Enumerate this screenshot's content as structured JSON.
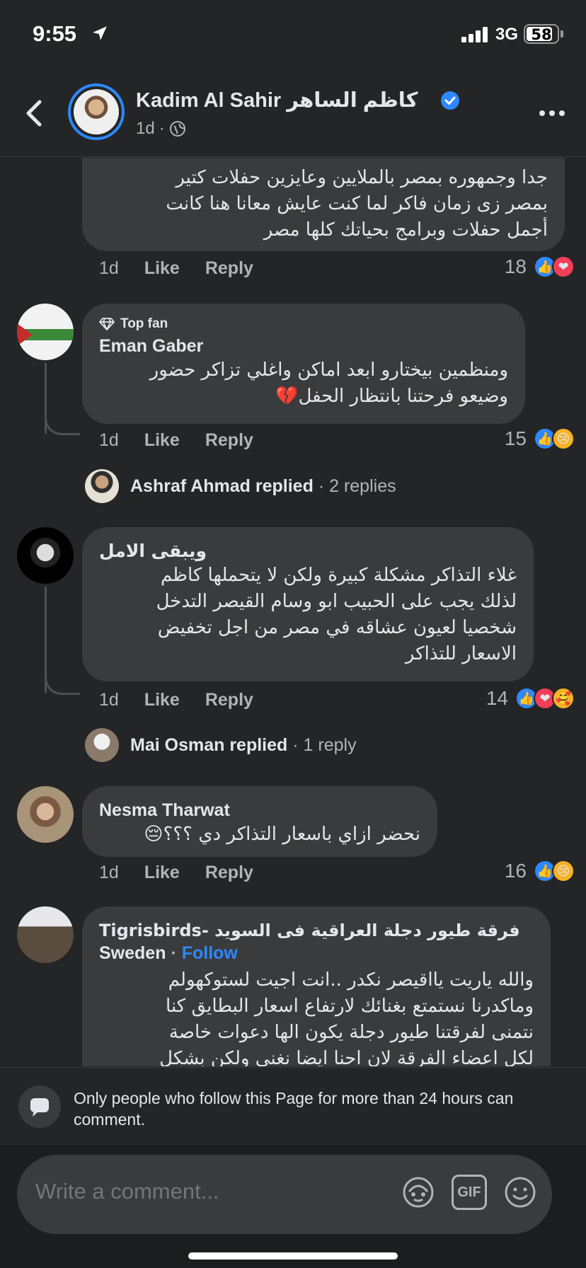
{
  "status": {
    "time": "9:55",
    "network": "3G",
    "battery": "58"
  },
  "header": {
    "name": "Kadim Al Sahir كاظم الساهر",
    "age": "1d",
    "meta_sep": "·"
  },
  "comments": [
    {
      "text_lines": [
        "جدا وجمهوره بمصر بالملايين وعايزين حفلات كتير",
        "بمصر زى زمان فاكر لما كنت عايش معانا هنا كانت",
        "أجمل حفلات وبرامج بحياتك كلها مصر"
      ],
      "time": "1d",
      "like": "Like",
      "reply": "Reply",
      "reactions": "18"
    },
    {
      "badge": "Top fan",
      "author": "Eman Gaber",
      "text_lines": [
        "ومنظمين بيختارو ابعد اماكن واغلي تزاكر حضور",
        "وضيعو فرحتنا بانتظار الحفل💔"
      ],
      "time": "1d",
      "like": "Like",
      "reply": "Reply",
      "reactions": "15",
      "replies": {
        "name": "Ashraf Ahmad",
        "verb": "replied",
        "count": "· 2 replies"
      }
    },
    {
      "author": "ويبقى الامل",
      "text_lines": [
        "غلاء التذاكر مشكلة كبيرة ولكن لا يتحملها كاظم",
        "لذلك يجب على الحبيب ابو وسام القيصر التدخل",
        "شخصيا لعيون عشاقه في مصر من اجل تخفيض",
        "الاسعار للتذاكر"
      ],
      "time": "1d",
      "like": "Like",
      "reply": "Reply",
      "reactions": "14",
      "replies": {
        "name": "Mai Osman",
        "verb": "replied",
        "count": "· 1 reply"
      }
    },
    {
      "author": "Nesma Tharwat",
      "text_lines": [
        "نحضر ازاي باسعار التذاكر دي ؟؟؟😔"
      ],
      "time": "1d",
      "like": "Like",
      "reply": "Reply",
      "reactions": "16"
    },
    {
      "author_line1": "فرقة طيور دجلة العراقية فى السويد -Tigrisbirds",
      "author_line2": "Sweden",
      "follow": "Follow",
      "text_lines": [
        "والله ياريت يااقيصر نكدر ..انت اجيت لستوكهولم",
        "وماكدرنا نستمتع بغنائك لارتفاع اسعار البطايق كنا",
        "نتمنى لفرقتنا طيور دجلة  يكون الها دعوات خاصة",
        "لكل اعضاء الفرقة لان احنا ايضا نغني ولكن بشكل"
      ]
    }
  ],
  "notice": "Only people who follow this Page for more than 24 hours can comment.",
  "composer": {
    "placeholder": "Write a comment...",
    "gif": "GIF"
  },
  "colors": {
    "accent": "#2d88ff",
    "background": "#242526",
    "bubble": "#3a3b3c"
  }
}
